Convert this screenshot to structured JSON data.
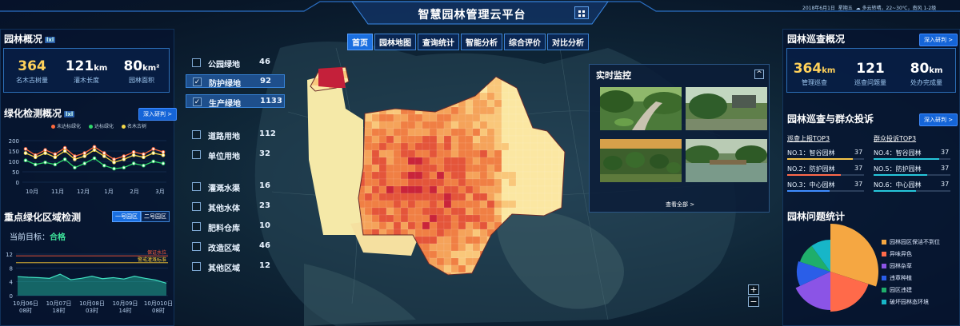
{
  "header": {
    "title": "智慧园林管理云平台",
    "date": "2018年6月1日",
    "weekday": "星期五",
    "weather": "多云转晴，22~30℃，南风 1-2级"
  },
  "nav": [
    "首页",
    "园林地图",
    "查询统计",
    "智能分析",
    "综合评价",
    "对比分析"
  ],
  "overview": {
    "title": "园林概况",
    "tag": "lxl",
    "items": [
      {
        "value": "364",
        "unit": "",
        "label": "名木古树量"
      },
      {
        "value": "121",
        "unit": "km",
        "label": "灌木长度"
      },
      {
        "value": "80",
        "unit": "km²",
        "label": "园林面积"
      }
    ]
  },
  "greening": {
    "title": "绿化检测概况",
    "tag": "lxl",
    "more": "深入研判 >",
    "legend": [
      "未达标绿化",
      "达标绿化",
      "名木古树"
    ],
    "colors": [
      "#ff6a3d",
      "#2fd76a",
      "#f5d94a"
    ],
    "chart_data": {
      "type": "line",
      "x": [
        "10月",
        "11月",
        "12月",
        "1月",
        "2月",
        "3月"
      ],
      "ylim": [
        0,
        200
      ],
      "yticks": [
        "200",
        "150",
        "100",
        "50",
        "0"
      ],
      "series": [
        {
          "name": "未达标绿化",
          "values": [
            160,
            130,
            155,
            135,
            165,
            125,
            140,
            170,
            140,
            110,
            125,
            145,
            135,
            160,
            145
          ]
        },
        {
          "name": "名木古树",
          "values": [
            140,
            120,
            140,
            120,
            150,
            110,
            125,
            155,
            125,
            95,
            110,
            130,
            120,
            140,
            130
          ]
        },
        {
          "name": "达标绿化",
          "values": [
            105,
            85,
            95,
            85,
            110,
            70,
            90,
            115,
            80,
            65,
            70,
            90,
            80,
            100,
            90
          ]
        }
      ]
    }
  },
  "keyzone": {
    "title": "重点绿化区域检测",
    "tabs": [
      "一号园区",
      "二号园区"
    ],
    "target_label": "当前目标：",
    "target_value": "合格",
    "chart_data": {
      "type": "area",
      "x": [
        "10月06日 08时",
        "10月07日 18时",
        "10月08日 03时",
        "10月09日 14时",
        "10月010日 08时"
      ],
      "ylim": [
        0,
        12
      ],
      "yticks": [
        "12",
        "8",
        "4",
        "0"
      ],
      "values": [
        5.5,
        5.3,
        5.2,
        5,
        6.2,
        4.6,
        5,
        5.6,
        4.9,
        5.2,
        4.8,
        5.6,
        5,
        4.5,
        3.6
      ],
      "thresholds": [
        {
          "name": "保证水位",
          "value": 11.5,
          "color": "#ff5a3c"
        },
        {
          "name": "警戒灌溉标准",
          "value": 9.5,
          "color": "#ffcc33"
        }
      ]
    }
  },
  "categories": [
    {
      "name": "公园绿地",
      "value": "46",
      "checked": false
    },
    {
      "name": "防护绿地",
      "value": "92",
      "checked": true
    },
    {
      "name": "生产绿地",
      "value": "1133",
      "checked": true
    },
    {
      "name": "道路用地",
      "value": "112",
      "checked": false
    },
    {
      "name": "单位用地",
      "value": "32",
      "checked": false
    },
    {
      "name": "灌溉水渠",
      "value": "16",
      "checked": false
    },
    {
      "name": "其他水体",
      "value": "23",
      "checked": false
    },
    {
      "name": "肥料仓库",
      "value": "10",
      "checked": false
    },
    {
      "name": "改造区域",
      "value": "46",
      "checked": false
    },
    {
      "name": "其他区域",
      "value": "12",
      "checked": false
    }
  ],
  "monitor": {
    "title": "实时监控",
    "viewall": "查看全部 >"
  },
  "patrol": {
    "title": "园林巡查概况",
    "more": "深入研判 >",
    "items": [
      {
        "value": "364",
        "unit": "km",
        "label": "管理巡查"
      },
      {
        "value": "121",
        "unit": "",
        "label": "巡查问题量"
      },
      {
        "value": "80",
        "unit": "km",
        "label": "处办完成量"
      }
    ]
  },
  "complaints": {
    "title": "园林巡查与群众投诉",
    "more": "深入研判 >",
    "left": {
      "title": "巡查上报TOP3",
      "rows": [
        {
          "rank": "NO.1：",
          "name": "智谷园林",
          "value": "37",
          "pct": 0.85,
          "color": "#f6c64a"
        },
        {
          "rank": "NO.2：",
          "name": "防护园林",
          "value": "37",
          "pct": 0.7,
          "color": "#ff6a4a"
        },
        {
          "rank": "NO.3：",
          "name": "中心园林",
          "value": "37",
          "pct": 0.55,
          "color": "#3f8cff"
        }
      ]
    },
    "right": {
      "title": "群众投诉TOP3",
      "rows": [
        {
          "rank": "NO.4：",
          "name": "智谷园林",
          "value": "37",
          "pct": 0.85,
          "color": "#26c6da"
        },
        {
          "rank": "NO.5：",
          "name": "防护园林",
          "value": "37",
          "pct": 0.7,
          "color": "#26c6da"
        },
        {
          "rank": "NO.6：",
          "name": "中心园林",
          "value": "37",
          "pct": 0.55,
          "color": "#26c6da"
        }
      ]
    }
  },
  "problems": {
    "title": "园林问题统计",
    "chart_data": {
      "type": "pie",
      "slices": [
        {
          "label": "园林园区保洁不到位",
          "value": 30,
          "color": "#f5a742"
        },
        {
          "label": "异味异色",
          "value": 20,
          "color": "#ff6a4a"
        },
        {
          "label": "园林杂草",
          "value": 18,
          "color": "#8b54e6"
        },
        {
          "label": "违章种植",
          "value": 12,
          "color": "#2a5ee8"
        },
        {
          "label": "园区违建",
          "value": 10,
          "color": "#1fae6b"
        },
        {
          "label": "破坏园林态环境",
          "value": 10,
          "color": "#17b6c8"
        }
      ]
    }
  }
}
